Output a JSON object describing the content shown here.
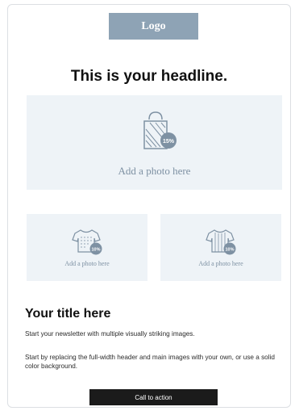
{
  "logo": {
    "label": "Logo"
  },
  "headline": "This is your headline.",
  "photos": {
    "main": {
      "caption": "Add a photo here",
      "badge": "15%",
      "icon": "shopping-bag-icon"
    },
    "left": {
      "caption": "Add a photo here",
      "badge": "10%",
      "icon": "tshirt-icon"
    },
    "right": {
      "caption": "Add a photo here",
      "badge": "10%",
      "icon": "striped-tshirt-icon"
    }
  },
  "section": {
    "title": "Your title here",
    "paragraphs": [
      "Start your newsletter with multiple visually striking images.",
      "Start by replacing the full-width header and main images with your own, or use a solid color background."
    ]
  },
  "cta": {
    "label": "Call to action"
  },
  "colors": {
    "logo_bg": "#8ea3b5",
    "photo_bg": "#eef3f7",
    "icon": "#7e91a3",
    "cta_bg": "#1b1b1b"
  }
}
